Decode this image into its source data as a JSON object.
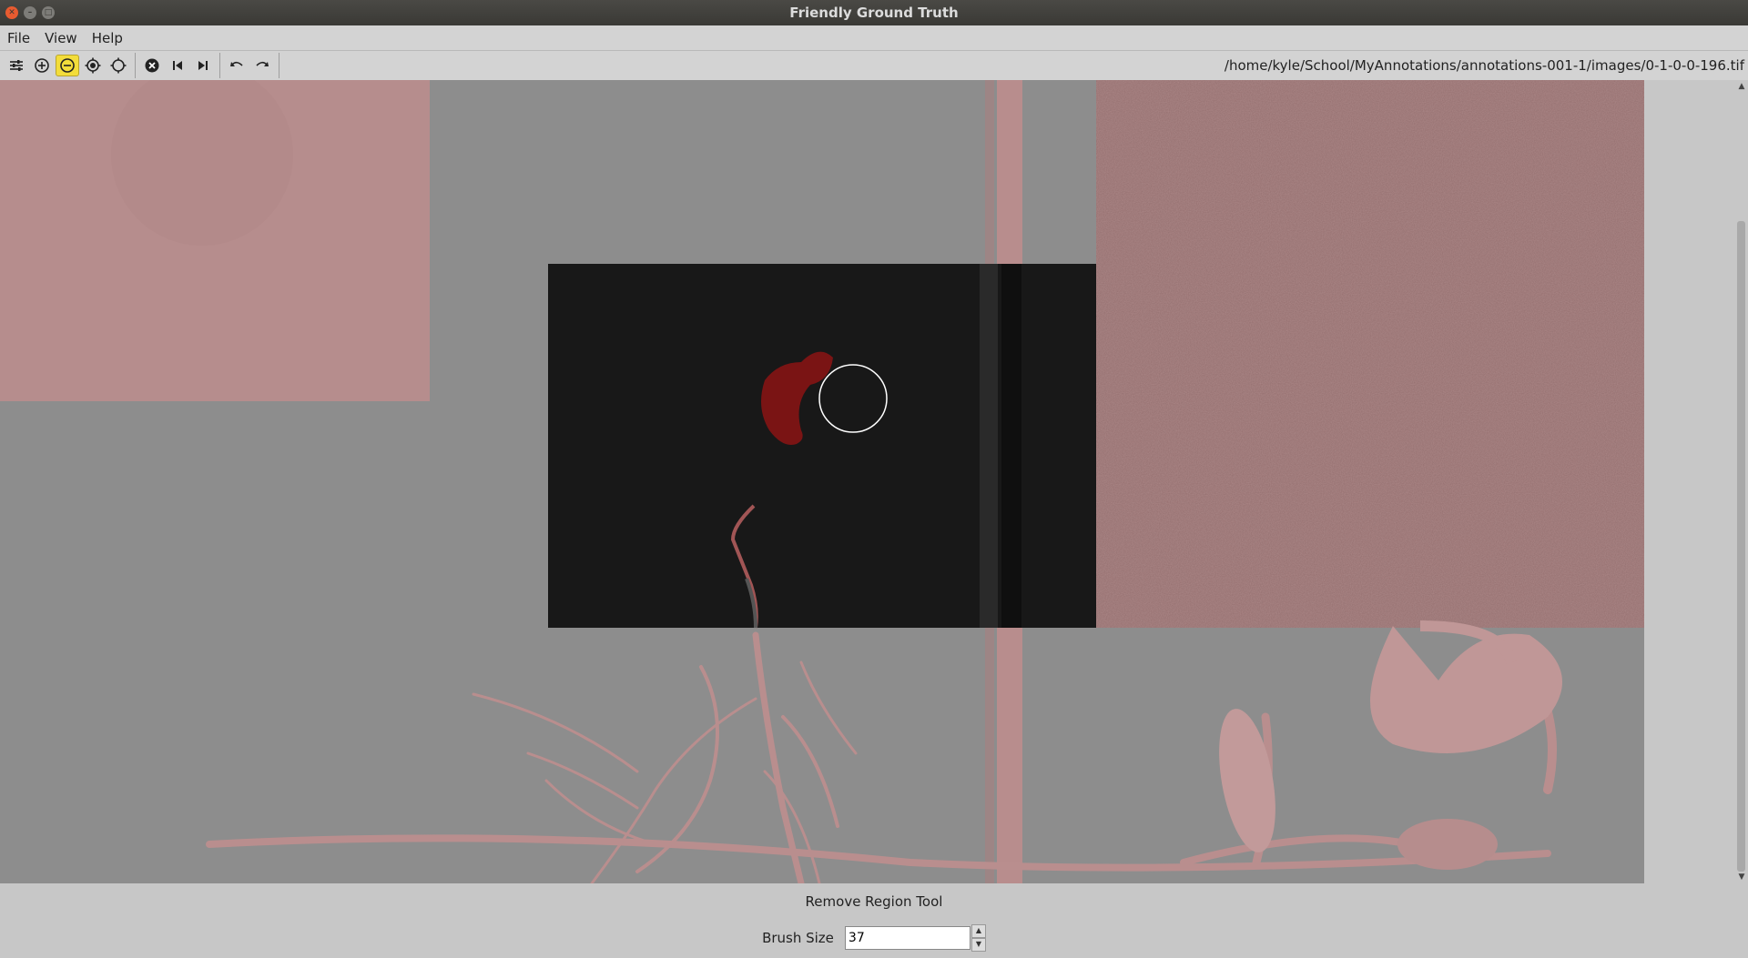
{
  "window": {
    "title": "Friendly Ground Truth"
  },
  "menu": {
    "items": [
      "File",
      "View",
      "Help"
    ]
  },
  "toolbar": {
    "file_path": "/home/kyle/School/MyAnnotations/annotations-001-1/images/0-1-0-0-196.tif",
    "tools": [
      "adjust-icon",
      "add-region-icon",
      "remove-region-icon",
      "add-point-icon",
      "remove-point-icon"
    ],
    "active_tool": "remove-region-icon",
    "nav": [
      "discard-icon",
      "prev-image-icon",
      "next-image-icon"
    ],
    "history": [
      "undo-icon",
      "redo-icon"
    ]
  },
  "status": {
    "tool_name": "Remove Region Tool",
    "brush_label": "Brush Size",
    "brush_value": "37"
  },
  "colors": {
    "active_tool": "#f3dd3b",
    "annotation": "#8a1818",
    "overlay": "#b07a7a"
  }
}
